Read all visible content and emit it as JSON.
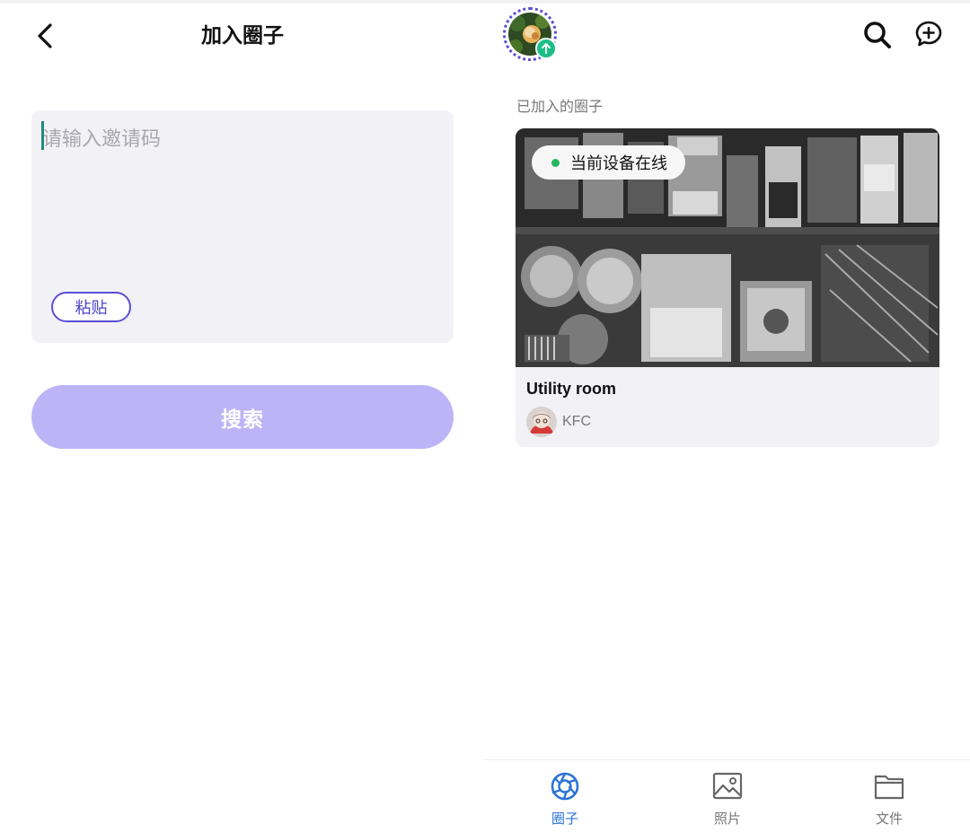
{
  "join_page": {
    "title": "加入圈子",
    "invite_placeholder": "请输入邀请码",
    "paste_label": "粘贴",
    "search_label": "搜索"
  },
  "circles_page": {
    "section_label": "已加入的圈子",
    "circle": {
      "status": "当前设备在线",
      "name": "Utility room",
      "owner": "KFC"
    },
    "nav": [
      {
        "label": "圈子",
        "icon": "aperture-icon",
        "active": true
      },
      {
        "label": "照片",
        "icon": "image-icon",
        "active": false
      },
      {
        "label": "文件",
        "icon": "folder-icon",
        "active": false
      }
    ]
  },
  "colors": {
    "accent": "#5b4ed6",
    "search_button": "#bdb4f7",
    "online": "#22b85c",
    "nav_active": "#2b73d6",
    "upload_badge": "#1bbf85"
  }
}
